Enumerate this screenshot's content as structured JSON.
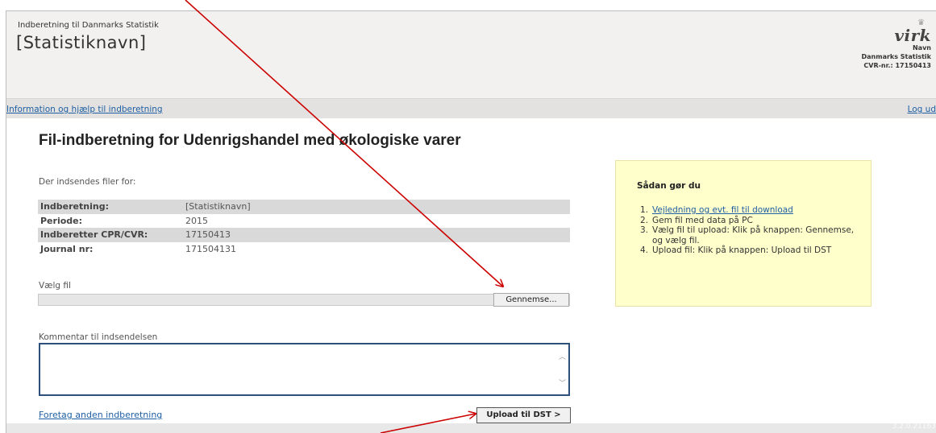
{
  "header": {
    "subtitle": "Indberetning til Danmarks Statistik",
    "title": "[Statistiknavn]",
    "logo": {
      "brand": "virk",
      "name_label": "Navn",
      "org": "Danmarks Statistik",
      "cvr": "CVR-nr.: 17150413"
    }
  },
  "nav": {
    "help_link": "Information og hjælp til indberetning",
    "logout_link": "Log ud"
  },
  "main": {
    "heading": "Fil-indberetning for Udenrigshandel med økologiske varer",
    "sends_for": "Der indsendes filer for:",
    "info_rows": [
      {
        "label": "Indberetning:",
        "value": "[Statistiknavn]"
      },
      {
        "label": "Periode:",
        "value": "2015"
      },
      {
        "label": "Indberetter CPR/CVR:",
        "value": "17150413"
      },
      {
        "label": "Journal nr:",
        "value": "171504131"
      }
    ],
    "choose_file_label": "Vælg fil",
    "browse_button": "Gennemse...",
    "comment_label": "Kommentar til indsendelsen",
    "comment_value": "",
    "other_report_link": "Foretag anden indberetning",
    "upload_button": "Upload til DST >"
  },
  "help": {
    "title": "Sådan gør du",
    "steps": [
      {
        "num": "1.",
        "text": "Vejledning og evt. fil til download"
      },
      {
        "num": "2.",
        "text": "Gem fil med data på PC"
      },
      {
        "num": "3.",
        "text": "Vælg fil til upload: Klik på knappen: Gennemse, og vælg fil."
      },
      {
        "num": "4.",
        "text": "Upload fil: Klik på knappen: Upload til DST"
      }
    ]
  },
  "footer": {
    "version": "3.2.0.21163"
  },
  "colors": {
    "annotation_arrow": "#cc0000",
    "link": "#1f5fa3",
    "help_box": "#ffffcc",
    "header_bg": "#f2f1ef"
  }
}
